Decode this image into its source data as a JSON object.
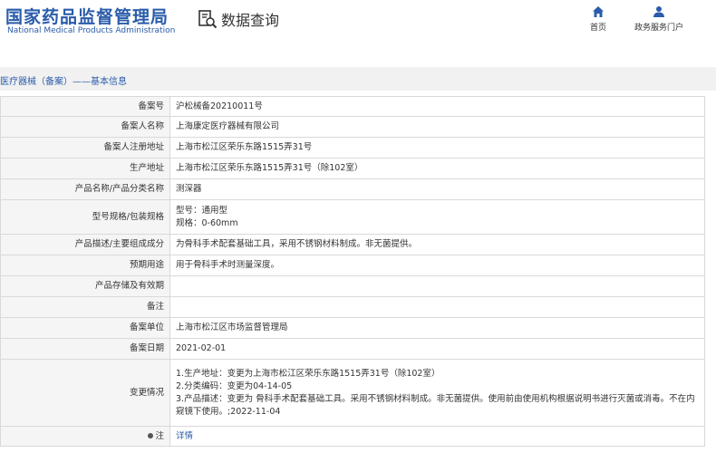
{
  "header": {
    "logo_cn": "国家药品监督管理局",
    "logo_en": "National Medical Products Administration",
    "query_label": "数据查询",
    "nav": [
      {
        "label": "首页",
        "icon": "home-icon"
      },
      {
        "label": "政务服务门户",
        "icon": "user-icon"
      }
    ]
  },
  "breadcrumb": "医疗器械（备案）——基本信息",
  "rows": [
    {
      "label": "备案号",
      "lines": [
        "沪松械备20210011号"
      ]
    },
    {
      "label": "备案人名称",
      "lines": [
        "上海康定医疗器械有限公司"
      ]
    },
    {
      "label": "备案人注册地址",
      "lines": [
        "上海市松江区荣乐东路1515弄31号"
      ]
    },
    {
      "label": "生产地址",
      "lines": [
        "上海市松江区荣乐东路1515弄31号（除102室）"
      ]
    },
    {
      "label": "产品名称/产品分类名称",
      "lines": [
        "测深器"
      ]
    },
    {
      "label": "型号规格/包装规格",
      "lines": [
        "型号：通用型",
        "规格：0-60mm"
      ]
    },
    {
      "label": "产品描述/主要组成成分",
      "lines": [
        "为骨科手术配套基础工具，采用不锈钢材料制成。非无菌提供。"
      ]
    },
    {
      "label": "预期用途",
      "lines": [
        "用于骨科手术时测量深度。"
      ]
    },
    {
      "label": "产品存储及有效期",
      "lines": [
        ""
      ]
    },
    {
      "label": "备注",
      "lines": [
        ""
      ]
    },
    {
      "label": "备案单位",
      "lines": [
        "上海市松江区市场监督管理局"
      ]
    },
    {
      "label": "备案日期",
      "lines": [
        "2021-02-01"
      ]
    },
    {
      "label": "变更情况",
      "lines": [
        "1.生产地址：变更为上海市松江区荣乐东路1515弄31号（除102室）",
        "2.分类编码：变更为04-14-05",
        "3.产品描述：变更为 骨科手术配套基础工具。采用不锈钢材料制成。非无菌提供。使用前由使用机构根据说明书进行灭菌或消毒。不在内窥镜下使用。;2022-11-04"
      ]
    }
  ],
  "note_row": {
    "label": "注",
    "link": "详情",
    "icon": "note-icon"
  },
  "colors": {
    "brand": "#2a5caa",
    "label_bg": "#f5f5f5",
    "border": "#d9d9d9"
  }
}
